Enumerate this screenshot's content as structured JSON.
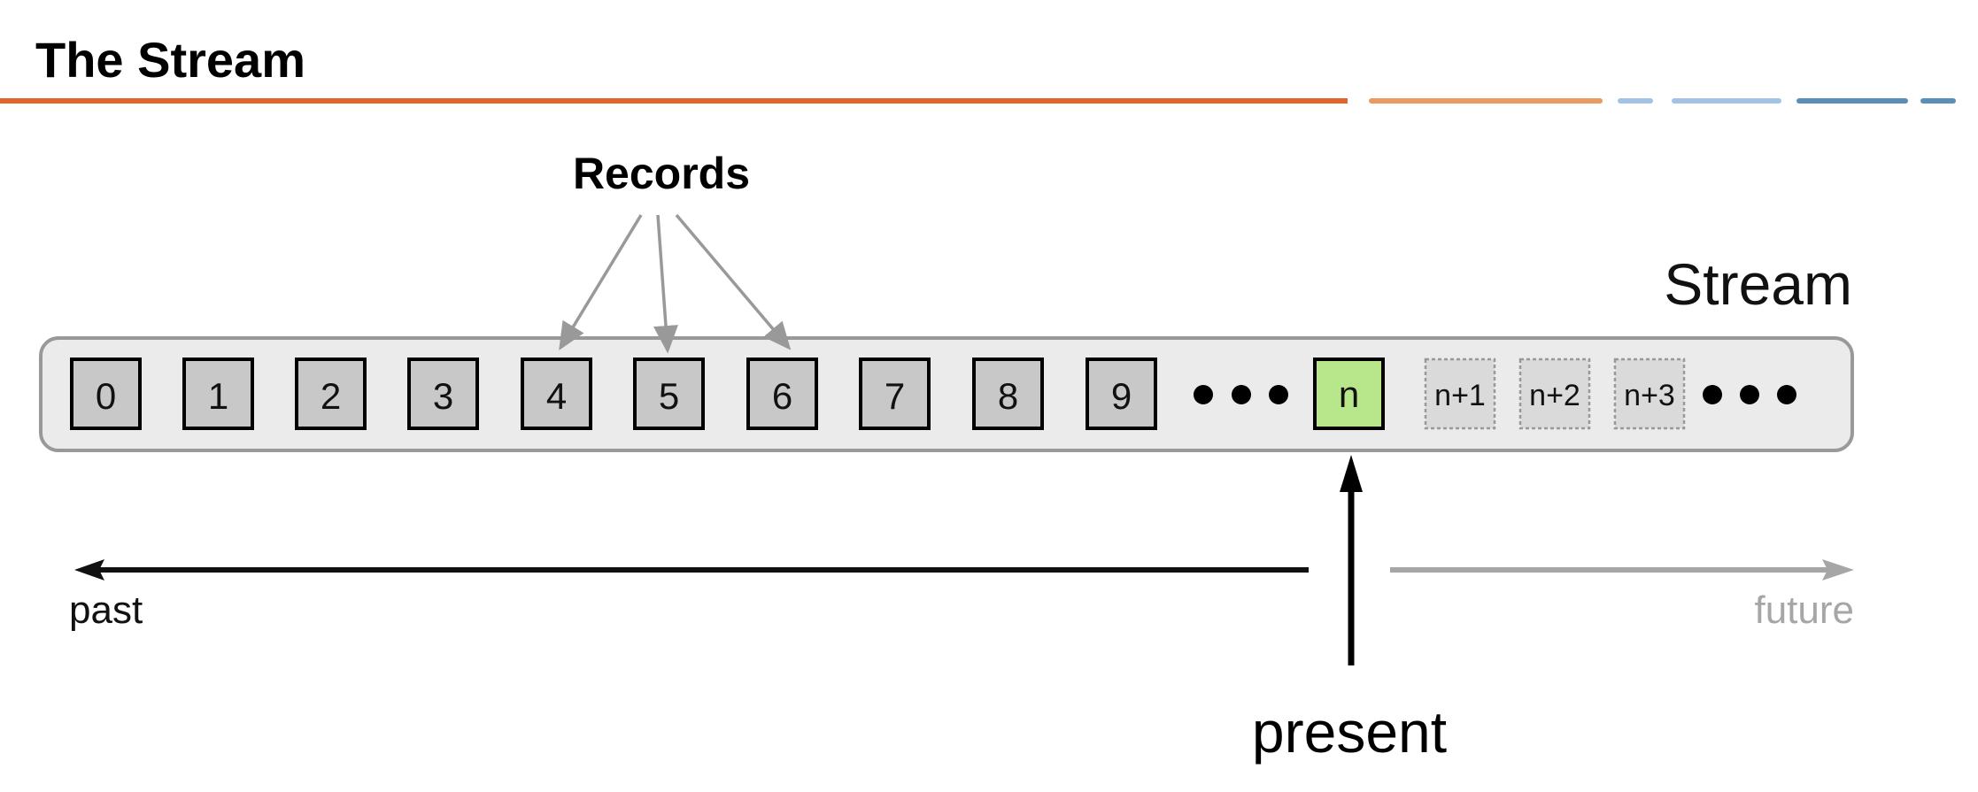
{
  "slide": {
    "title": "The Stream"
  },
  "header_rule": {
    "colors": {
      "primary_orange": "#e0652a",
      "light_orange": "#eb9a62",
      "light_blue": "#a3c3e6",
      "dark_blue": "#5a8fb7"
    }
  },
  "diagram": {
    "records_label": "Records",
    "stream_label": "Stream",
    "records": [
      "0",
      "1",
      "2",
      "3",
      "4",
      "5",
      "6",
      "7",
      "8",
      "9"
    ],
    "highlighted_record_indices": [
      4,
      5,
      6
    ],
    "current_record": "n",
    "future_records": [
      "n+1",
      "n+2",
      "n+3"
    ],
    "past_label": "past",
    "future_label": "future",
    "present_label": "present",
    "colors": {
      "stream_fill": "#ebebeb",
      "stream_border": "#999999",
      "record_fill": "#c8c8c8",
      "current_fill": "#b8e68a",
      "future_fill": "#dadada",
      "pointer_arrow": "#999999",
      "past_arrow": "#111111",
      "future_arrow": "#a6a6a6"
    }
  }
}
